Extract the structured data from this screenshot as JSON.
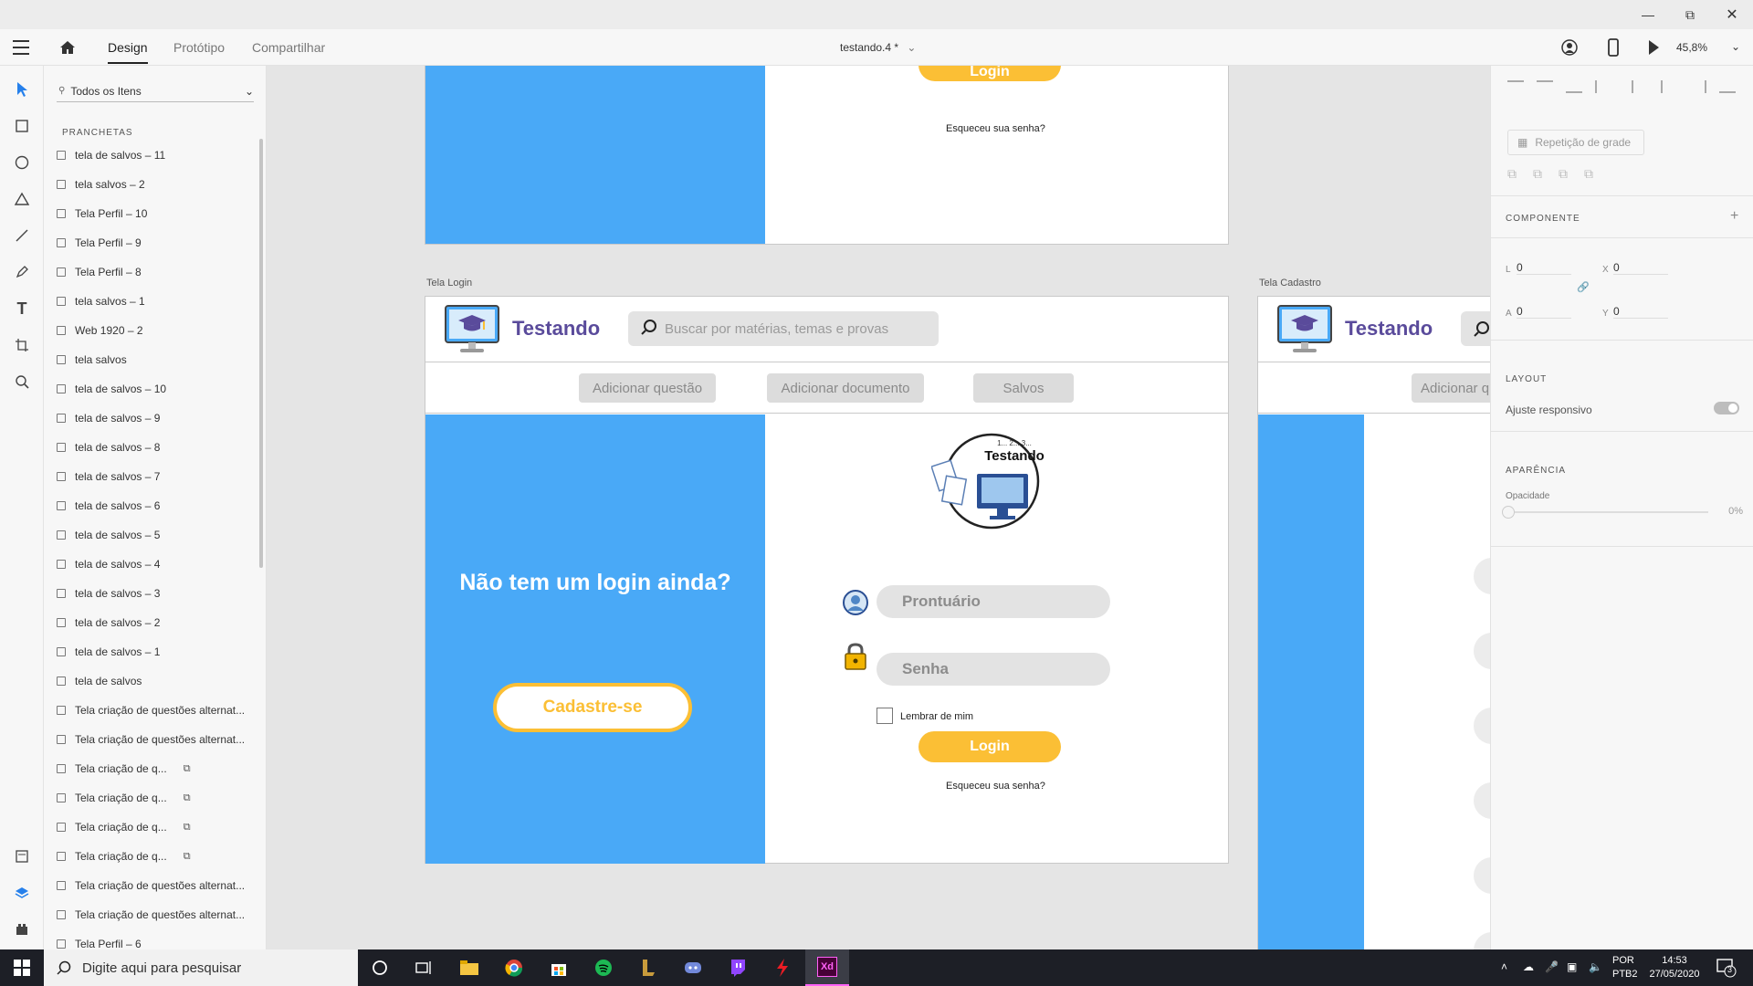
{
  "window": {
    "minimize_icon": "minimize-icon",
    "restore_icon": "restore-icon",
    "close_icon": "close-icon"
  },
  "header": {
    "tabs": [
      {
        "label": "Design"
      },
      {
        "label": "Protótipo"
      },
      {
        "label": "Compartilhar"
      }
    ],
    "doc_title": "testando.4 *",
    "zoom": "45,8%"
  },
  "layers_panel": {
    "search_label": "Todos os Itens",
    "section": "PRANCHETAS",
    "items": [
      "tela de salvos – 11",
      "tela salvos – 2",
      "Tela Perfil – 10",
      "Tela Perfil – 9",
      "Tela Perfil – 8",
      "tela salvos – 1",
      "Web 1920 – 2",
      "tela salvos",
      "tela de salvos – 10",
      "tela de salvos – 9",
      "tela de salvos – 8",
      "tela de salvos – 7",
      "tela de salvos – 6",
      "tela de salvos – 5",
      "tela de salvos – 4",
      "tela de salvos – 3",
      "tela de salvos – 2",
      "tela de salvos – 1",
      "tela de salvos",
      "Tela criação de questões  alternat...",
      "Tela criação de questões  alternat...",
      "Tela criação de q...",
      "Tela criação de q...",
      "Tela criação de q...",
      "Tela criação de q...",
      "Tela criação de questões  alternat...",
      "Tela criação de questões  alternat...",
      "Tela Perfil – 6"
    ]
  },
  "canvas": {
    "top_board": {
      "login_label": "Login",
      "forgot": "Esqueceu sua senha?"
    },
    "login_board": {
      "label": "Tela Login",
      "brand": "Testando",
      "search_placeholder": "Buscar por matérias, temas e provas",
      "nav": [
        "Adicionar questão",
        "Adicionar documento",
        "Salvos"
      ],
      "left_heading": "Não tem um login ainda?",
      "signup_button": "Cadastre-se",
      "logo_top": "1... 2... 3...",
      "logo_text": "Testando",
      "user_field": "Prontuário",
      "password_field": "Senha",
      "remember": "Lembrar de mim",
      "login_button": "Login",
      "forgot": "Esqueceu sua senha?"
    },
    "cadastro_board": {
      "label": "Tela Cadastro",
      "brand": "Testando",
      "nav_partial": "Adicionar q"
    }
  },
  "properties": {
    "grid_repeat": "Repetição de grade",
    "component": "COMPONENTE",
    "w_label": "L",
    "w_value": "0",
    "h_label": "A",
    "h_value": "0",
    "x_label": "X",
    "x_value": "0",
    "y_label": "Y",
    "y_value": "0",
    "layout": "LAYOUT",
    "responsive": "Ajuste responsivo",
    "appearance": "APARÊNCIA",
    "opacity_label": "Opacidade",
    "opacity_value": "0%"
  },
  "taskbar": {
    "search_placeholder": "Digite aqui para pesquisar",
    "lang1": "POR",
    "lang2": "PTB2",
    "time": "14:53",
    "date": "27/05/2020",
    "notif_count": "3"
  },
  "colors": {
    "accent_blue": "#49a9f7",
    "accent_gold": "#fbbf35",
    "brand_purple": "#5a4b9b"
  }
}
